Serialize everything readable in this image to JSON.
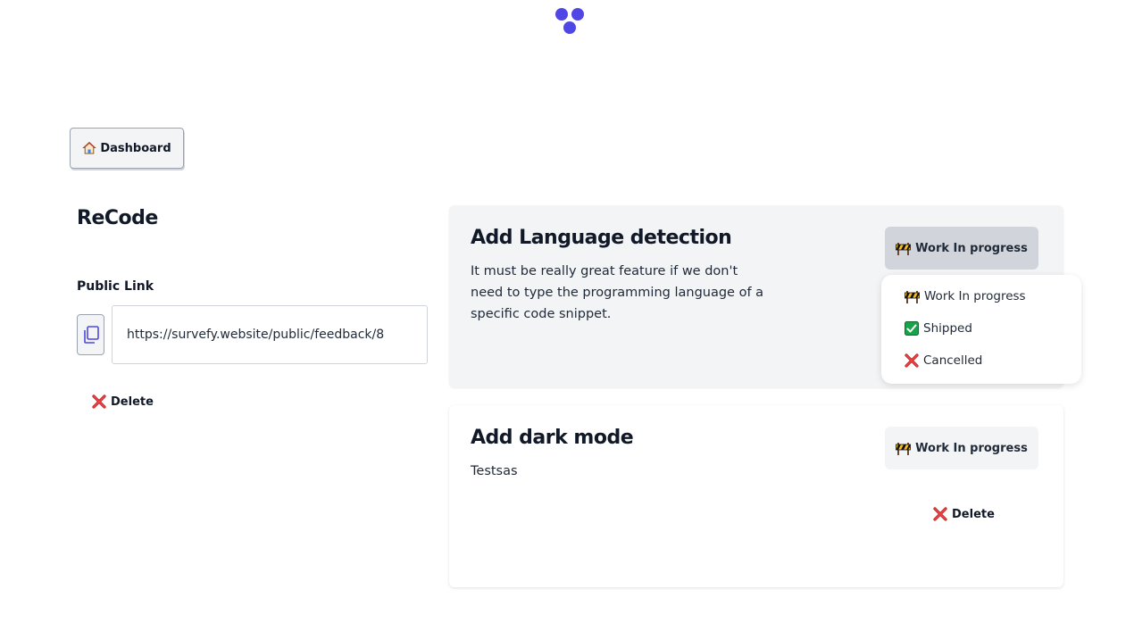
{
  "header": {
    "logo_icon": "logo-icon",
    "accent_color": "#4f46e5"
  },
  "nav": {
    "dashboard_label": "Dashboard",
    "dashboard_icon": "house-icon"
  },
  "project": {
    "title": "ReCode",
    "public_link_label": "Public Link",
    "public_link_value": "https://survefy.website/public/feedback/8",
    "delete_label": "Delete"
  },
  "feedback": [
    {
      "title": "Add Language detection",
      "description": "It must be really great feature if we don't need to type the programming language of a specific code snippet.",
      "status": "Work In progress"
    },
    {
      "title": "Add dark mode",
      "description": "Testsas",
      "status": "Work In progress",
      "delete_label": "Delete"
    }
  ],
  "status_menu": {
    "options": [
      "Work In progress",
      "Shipped",
      "Cancelled"
    ]
  }
}
